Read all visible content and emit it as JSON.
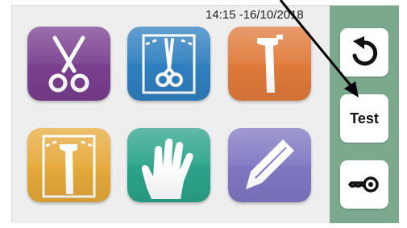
{
  "status": {
    "datetime": "14:15 -16/10/2018"
  },
  "tiles": [
    {
      "name": "instruments",
      "color": "#7a3f8f"
    },
    {
      "name": "sterilized-instruments",
      "color": "#2f7fc0"
    },
    {
      "name": "handpiece",
      "color": "#e07a3a"
    },
    {
      "name": "sterilized-handpiece",
      "color": "#e6a93b"
    },
    {
      "name": "gloves",
      "color": "#2ba38a"
    },
    {
      "name": "edit",
      "color": "#7f77c3"
    }
  ],
  "sidebar": {
    "background": "#7ba98e",
    "buttons": [
      {
        "name": "back",
        "icon": "undo-arrow-icon"
      },
      {
        "name": "test",
        "label": "Test"
      },
      {
        "name": "key",
        "icon": "key-icon"
      }
    ]
  }
}
